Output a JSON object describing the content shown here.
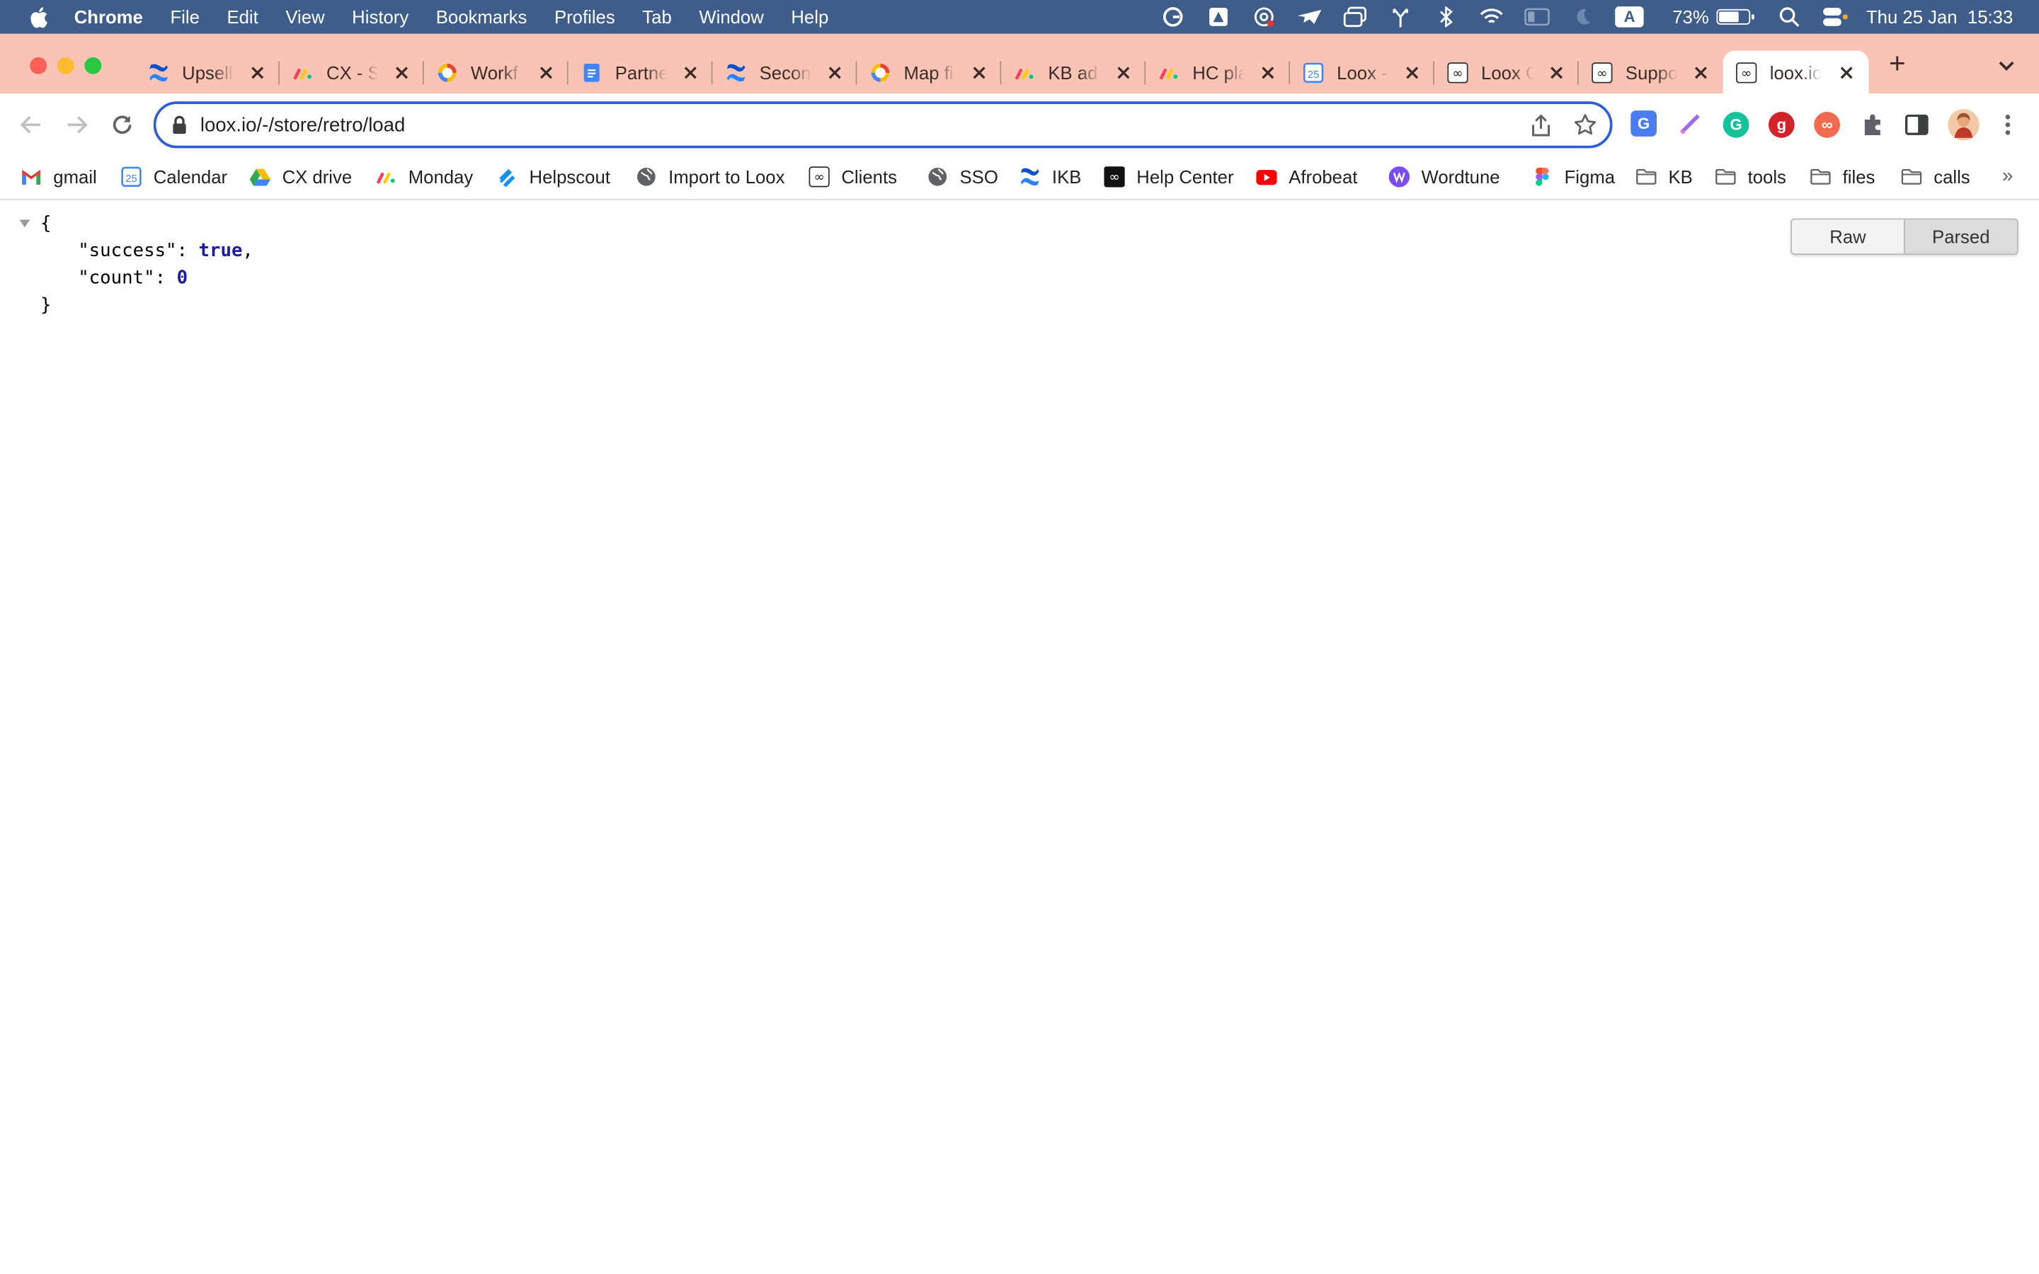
{
  "menubar": {
    "app_name": "Chrome",
    "items": [
      "File",
      "Edit",
      "View",
      "History",
      "Bookmarks",
      "Profiles",
      "Tab",
      "Window",
      "Help"
    ],
    "battery_percent": "73%",
    "battery_level": 0.73,
    "datetime": "Thu 25 Jan  15:33",
    "status_icons": [
      "grammarly-icon",
      "drive-sync-icon",
      "at-sign-icon",
      "airplane-icon",
      "screens-icon",
      "fork-icon",
      "bluetooth-icon",
      "wifi-icon",
      "display-icon",
      "moon-icon",
      "keyboard-input-icon",
      "search-icon",
      "control-center-icon"
    ],
    "input_source": "A"
  },
  "tabs": [
    {
      "title": "Upsell",
      "icon": "confluence-icon"
    },
    {
      "title": "CX - S",
      "icon": "monday-icon"
    },
    {
      "title": "Workf",
      "icon": "google-circle-icon"
    },
    {
      "title": "Partne",
      "icon": "google-docs-icon"
    },
    {
      "title": "Secon",
      "icon": "confluence-icon"
    },
    {
      "title": "Map fi",
      "icon": "google-circle-icon"
    },
    {
      "title": "KB ad",
      "icon": "monday-icon"
    },
    {
      "title": "HC pla",
      "icon": "monday-icon"
    },
    {
      "title": "Loox -",
      "icon": "google-calendar-icon"
    },
    {
      "title": "Loox C",
      "icon": "loox-icon"
    },
    {
      "title": "Suppo",
      "icon": "loox-icon"
    },
    {
      "title": "loox.io",
      "icon": "loox-icon",
      "active": true
    }
  ],
  "address_bar": {
    "url": "loox.io/-/store/retro/load"
  },
  "extensions": [
    "google-translate-icon",
    "pen-icon",
    "grammarly-ext-icon",
    "gmass-icon",
    "loox-ext-icon",
    "puzzle-icon",
    "side-panel-icon",
    "profile-avatar"
  ],
  "bookmarks": [
    {
      "label": "gmail",
      "icon": "gmail-icon"
    },
    {
      "label": "Calendar",
      "icon": "google-calendar-icon"
    },
    {
      "label": "CX drive",
      "icon": "google-drive-icon"
    },
    {
      "label": "Monday",
      "icon": "monday-icon"
    },
    {
      "label": "Helpscout",
      "icon": "helpscout-icon"
    },
    {
      "label": "Import to Loox",
      "icon": "globe-icon"
    },
    {
      "label": "Clients",
      "icon": "loox-icon"
    },
    {
      "label": "SSO",
      "icon": "globe-icon"
    },
    {
      "label": "IKB",
      "icon": "confluence-icon"
    },
    {
      "label": "Help Center",
      "icon": "loox-black-icon"
    },
    {
      "label": "Afrobeat",
      "icon": "youtube-icon"
    },
    {
      "label": "Wordtune",
      "icon": "wordtune-icon"
    },
    {
      "label": "Figma",
      "icon": "figma-icon"
    },
    {
      "label": "KB",
      "icon": "folder-icon"
    },
    {
      "label": "tools",
      "icon": "folder-icon"
    },
    {
      "label": "files",
      "icon": "folder-icon"
    },
    {
      "label": "calls",
      "icon": "folder-icon"
    }
  ],
  "bookmarks_more": "»",
  "json_view": {
    "open_brace": "{",
    "close_brace": "}",
    "entries": [
      {
        "key": "\"success\"",
        "value": "true",
        "trail": ","
      },
      {
        "key": "\"count\"",
        "value": "0",
        "trail": ""
      }
    ],
    "toggle": {
      "raw_label": "Raw",
      "parsed_label": "Parsed",
      "selected": "Parsed"
    }
  },
  "colors": {
    "menubar_bg": "#3f5d8a",
    "tabstrip_bg": "#f9c4b6",
    "omnibox_border": "#2b5ed8",
    "json_keyword": "#1a1aa6"
  }
}
